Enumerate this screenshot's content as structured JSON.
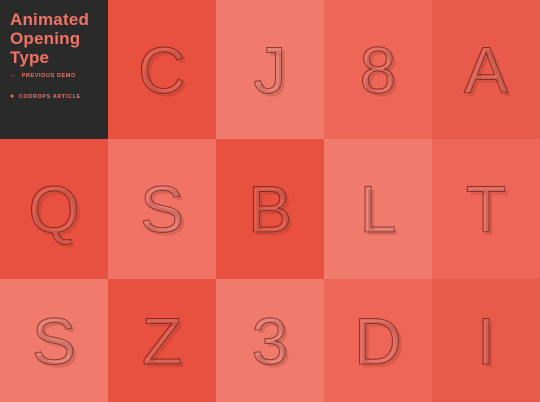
{
  "header": {
    "title": "Animated Opening Type",
    "previous_demo": "Previous Demo",
    "codrops_article": "Codrops Article",
    "previous_icon": "arrow-left-icon",
    "article_icon": "drop-icon"
  },
  "colors": {
    "info_bg": "#2b2a2b",
    "accent": "#f07465"
  },
  "tiles": [
    {
      "letter": "C",
      "bg": "#e8503f"
    },
    {
      "letter": "J",
      "bg": "#f07a6c"
    },
    {
      "letter": "8",
      "bg": "#ee6657"
    },
    {
      "letter": "A",
      "bg": "#e85a4a"
    },
    {
      "letter": "Q",
      "bg": "#e8503f"
    },
    {
      "letter": "S",
      "bg": "#f07365"
    },
    {
      "letter": "B",
      "bg": "#e8503f"
    },
    {
      "letter": "L",
      "bg": "#f07a6c"
    },
    {
      "letter": "T",
      "bg": "#ee6657"
    },
    {
      "letter": "S",
      "bg": "#f07a6c"
    },
    {
      "letter": "Z",
      "bg": "#e8503f"
    },
    {
      "letter": "3",
      "bg": "#f07a6c"
    },
    {
      "letter": "D",
      "bg": "#ee6657"
    },
    {
      "letter": "I",
      "bg": "#e85a4a"
    }
  ]
}
